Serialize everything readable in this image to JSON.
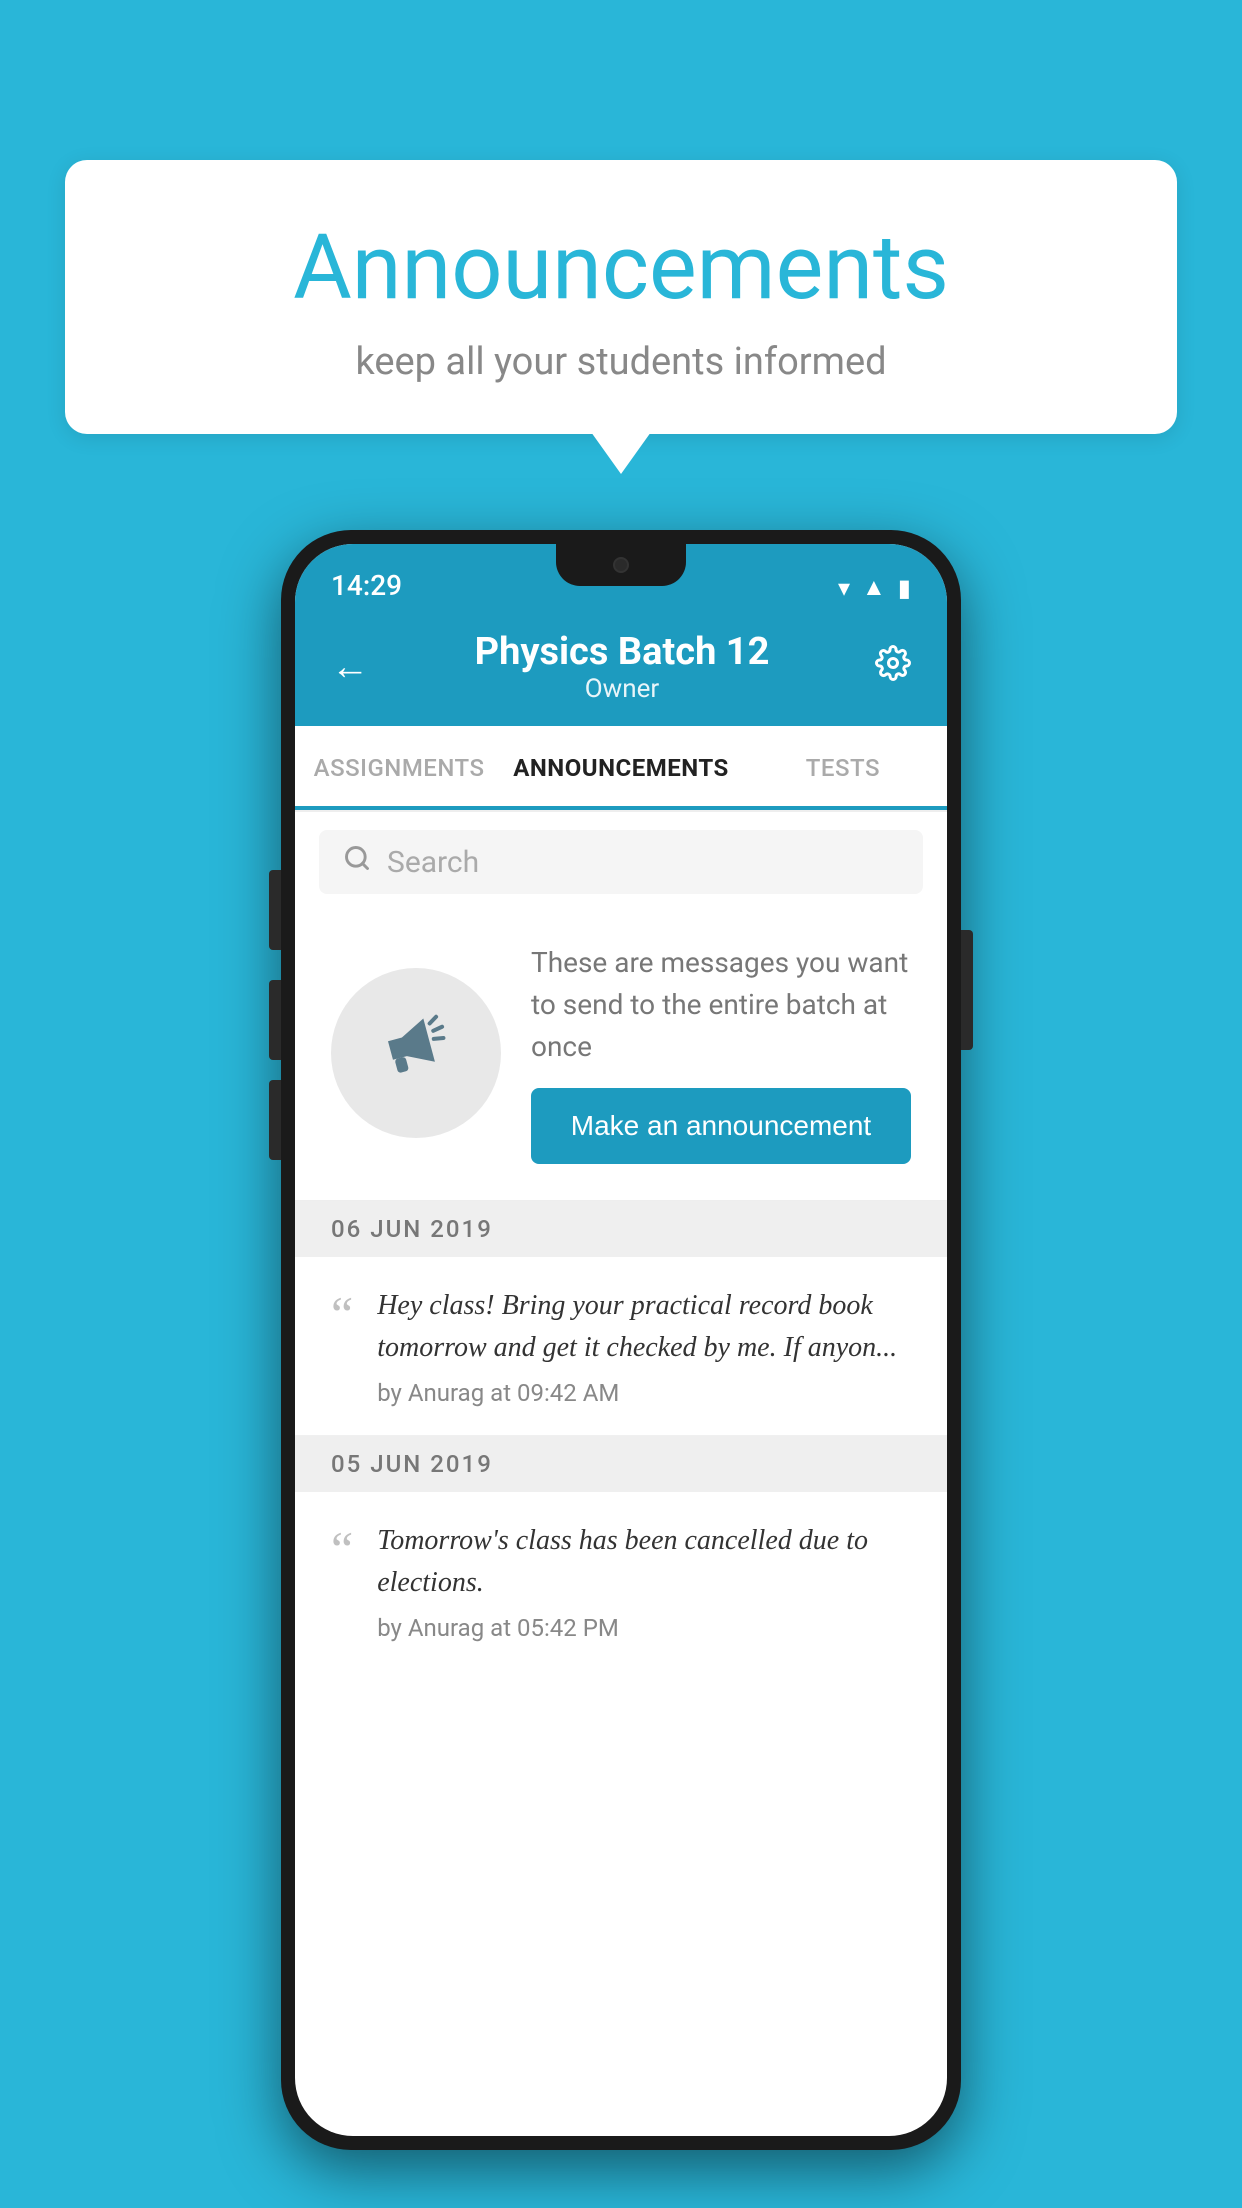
{
  "bubble": {
    "title": "Announcements",
    "subtitle": "keep all your students informed"
  },
  "phone": {
    "statusBar": {
      "time": "14:29"
    },
    "header": {
      "title": "Physics Batch 12",
      "subtitle": "Owner",
      "backLabel": "←",
      "settingsLabel": "⚙"
    },
    "tabs": [
      {
        "label": "ASSIGNMENTS",
        "active": false
      },
      {
        "label": "ANNOUNCEMENTS",
        "active": true
      },
      {
        "label": "TESTS",
        "active": false
      }
    ],
    "search": {
      "placeholder": "Search"
    },
    "promo": {
      "description": "These are messages you want to send to the entire batch at once",
      "buttonLabel": "Make an announcement"
    },
    "announcements": [
      {
        "date": "06  JUN  2019",
        "message": "Hey class! Bring your practical record book tomorrow and get it checked by me. If anyon...",
        "author": "by Anurag at 09:42 AM"
      },
      {
        "date": "05  JUN  2019",
        "message": "Tomorrow's class has been cancelled due to elections.",
        "author": "by Anurag at 05:42 PM"
      }
    ]
  },
  "colors": {
    "skyBlue": "#29b6d8",
    "headerBlue": "#1d9bbf",
    "buttonBlue": "#1d9bbf"
  }
}
